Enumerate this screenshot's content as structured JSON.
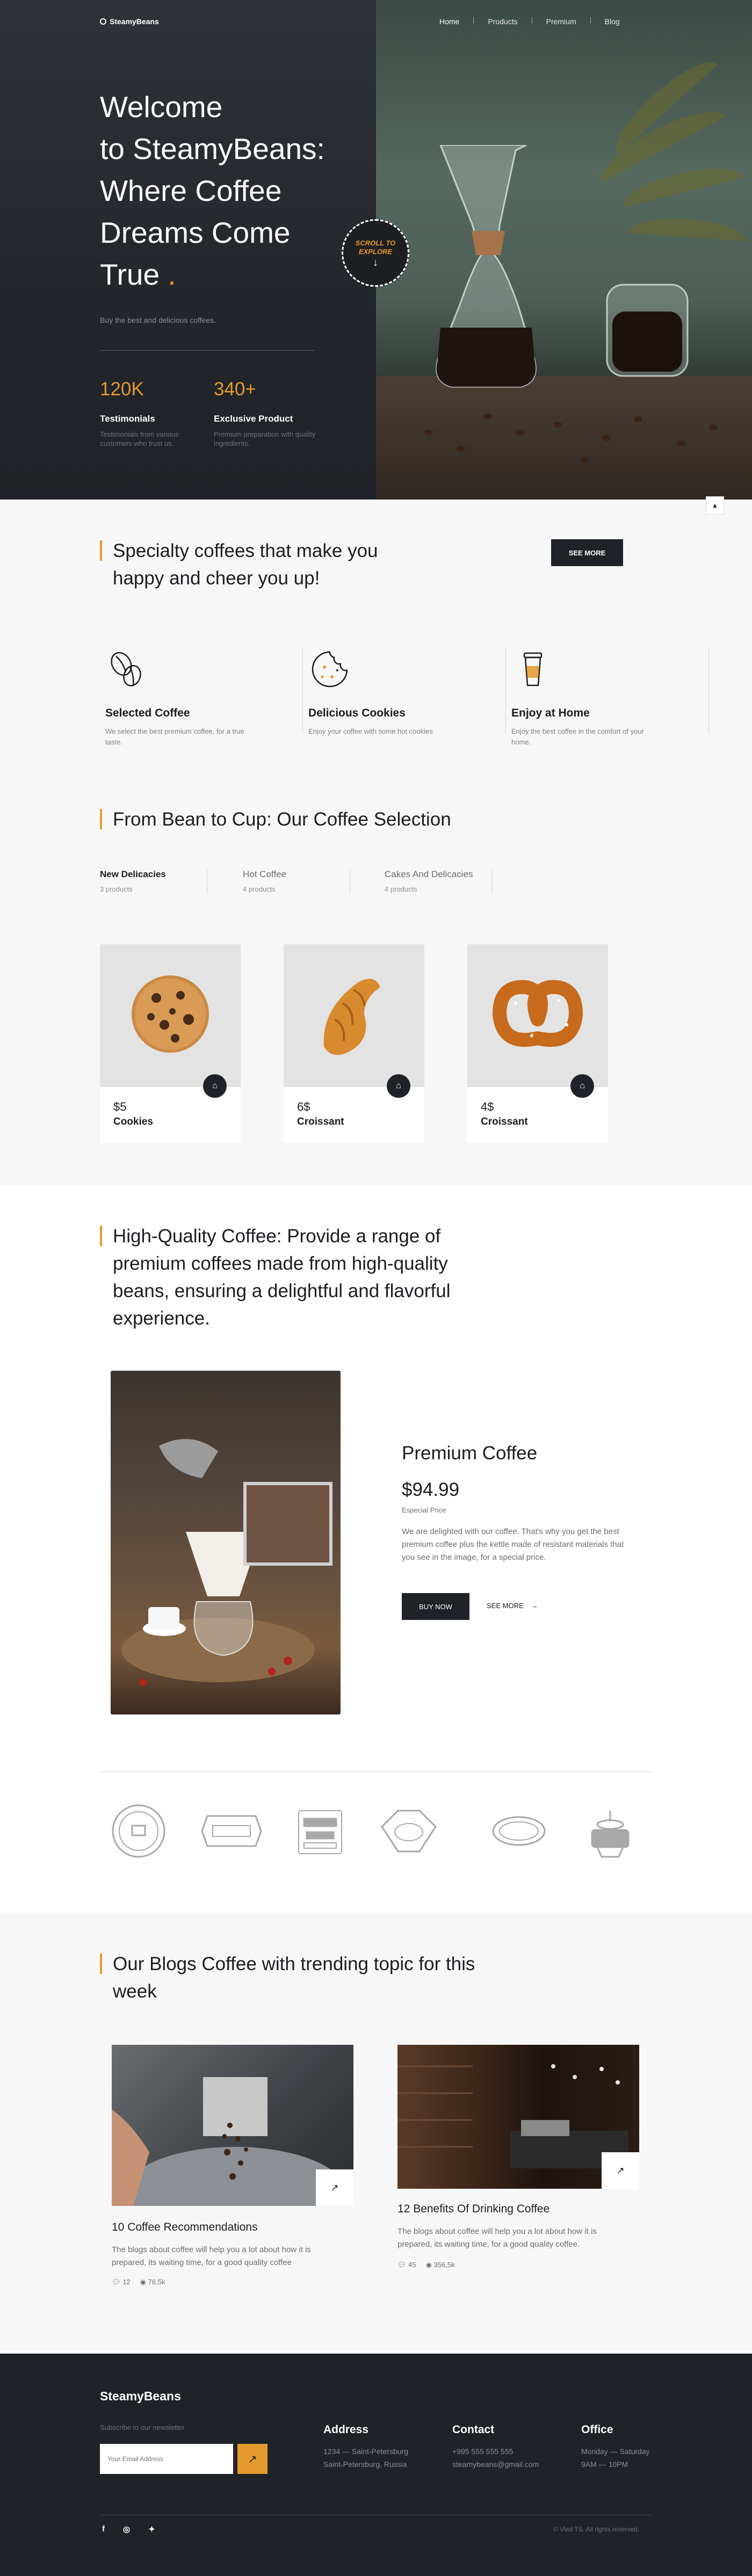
{
  "brand": {
    "name": "SteamyBeans"
  },
  "nav": {
    "items": [
      "Home",
      "Products",
      "Premium",
      "Blog"
    ]
  },
  "hero": {
    "title_lines": [
      "Welcome",
      "to SteamyBeans:",
      "Where Coffee",
      "Dreams Come",
      "True"
    ],
    "title_dot": ".",
    "subtitle": "Buy the best and delicious coffees.",
    "scroll_badge_lines": [
      "SCROLL TO",
      "EXPLORE"
    ],
    "stats": [
      {
        "value": "120K",
        "label": "Testimonials",
        "desc": "Testimonials from various customers who trust us."
      },
      {
        "value": "340+",
        "label": "Exclusive Product",
        "desc": "Premium preparation with quality ingredients."
      }
    ]
  },
  "specialty": {
    "title": "Specialty coffees that make you happy and cheer you up!",
    "see_more": "SEE MORE",
    "features": [
      {
        "icon": "coffee-beans-icon",
        "name": "Selected Coffee",
        "desc": "We select the best premium coffee, for a true taste."
      },
      {
        "icon": "cookie-icon",
        "name": "Delicious Cookies",
        "desc": "Enjoy your coffee with some hot cookies"
      },
      {
        "icon": "takeaway-cup-icon",
        "name": "Enjoy at Home",
        "desc": "Enjoy the best coffee in the comfort of your home."
      }
    ]
  },
  "selection": {
    "title": "From Bean to Cup: Our Coffee Selection",
    "categories": [
      {
        "name": "New Delicacies",
        "count": "3 products"
      },
      {
        "name": "Hot Coffee",
        "count": "4 products"
      },
      {
        "name": "Cakes And Delicacies",
        "count": "4 products"
      }
    ],
    "products": [
      {
        "price": "$5",
        "name": "Cookies",
        "icon": "cookie-image"
      },
      {
        "price": "6$",
        "name": "Croissant",
        "icon": "croissant-image"
      },
      {
        "price": "4$",
        "name": "Croissant",
        "icon": "pretzel-image"
      }
    ]
  },
  "premium": {
    "title": "High-Quality Coffee: Provide a range of premium coffees made from high-quality beans, ensuring a delightful and flavorful experience.",
    "product_name": "Premium Coffee",
    "price": "$94.99",
    "price_label": "Especial Price",
    "desc": "We are delighted with our coffee. That's why you get the best premium coffee plus the kettle made of resistant materials that you see in the image, for a special price.",
    "buy_now": "BUY NOW",
    "see_more": "SEE MORE"
  },
  "logos": {
    "items": [
      "coffee-shop-badge-1",
      "coffee-shop-badge-2",
      "coffee-tea-badge",
      "cafe-badge",
      "coffee-oval-badge",
      "coffee-shop-badge-3"
    ]
  },
  "blogs": {
    "title": "Our Blogs Coffee with trending topic for this week",
    "posts": [
      {
        "title": "10 Coffee Recommendations",
        "desc": "The blogs about coffee will help you a lot about how it is prepared, its waiting time, for a good quality coffee",
        "comments": "12",
        "views": "76,5k"
      },
      {
        "title": "12 Benefits Of Drinking Coffee",
        "desc": "The blogs about coffee will help you a lot about how it is prepared, its waiting time, for a good quality coffee.",
        "comments": "45",
        "views": "356,5k"
      }
    ]
  },
  "footer": {
    "brand": "SteamyBeans",
    "newsletter_label": "Subscribe to our newsletter",
    "email_placeholder": "Your Email Address",
    "columns": [
      {
        "title": "Address",
        "lines": [
          "1234 — Saint-Petersburg",
          "Saint-Petersburg, Russia"
        ]
      },
      {
        "title": "Contact",
        "lines": [
          "+995 555 555 555",
          "steamybeans@gmail.com"
        ]
      },
      {
        "title": "Office",
        "lines": [
          "Monday — Saturday",
          "9AM — 10PM"
        ]
      }
    ],
    "socials": [
      "facebook-icon",
      "instagram-icon",
      "twitter-icon"
    ],
    "copyright": "© Vlad TS. All rights reserved."
  },
  "colors": {
    "accent": "#e59a2d",
    "dark": "#1f2226",
    "gray_bg": "#f7f7f7"
  }
}
